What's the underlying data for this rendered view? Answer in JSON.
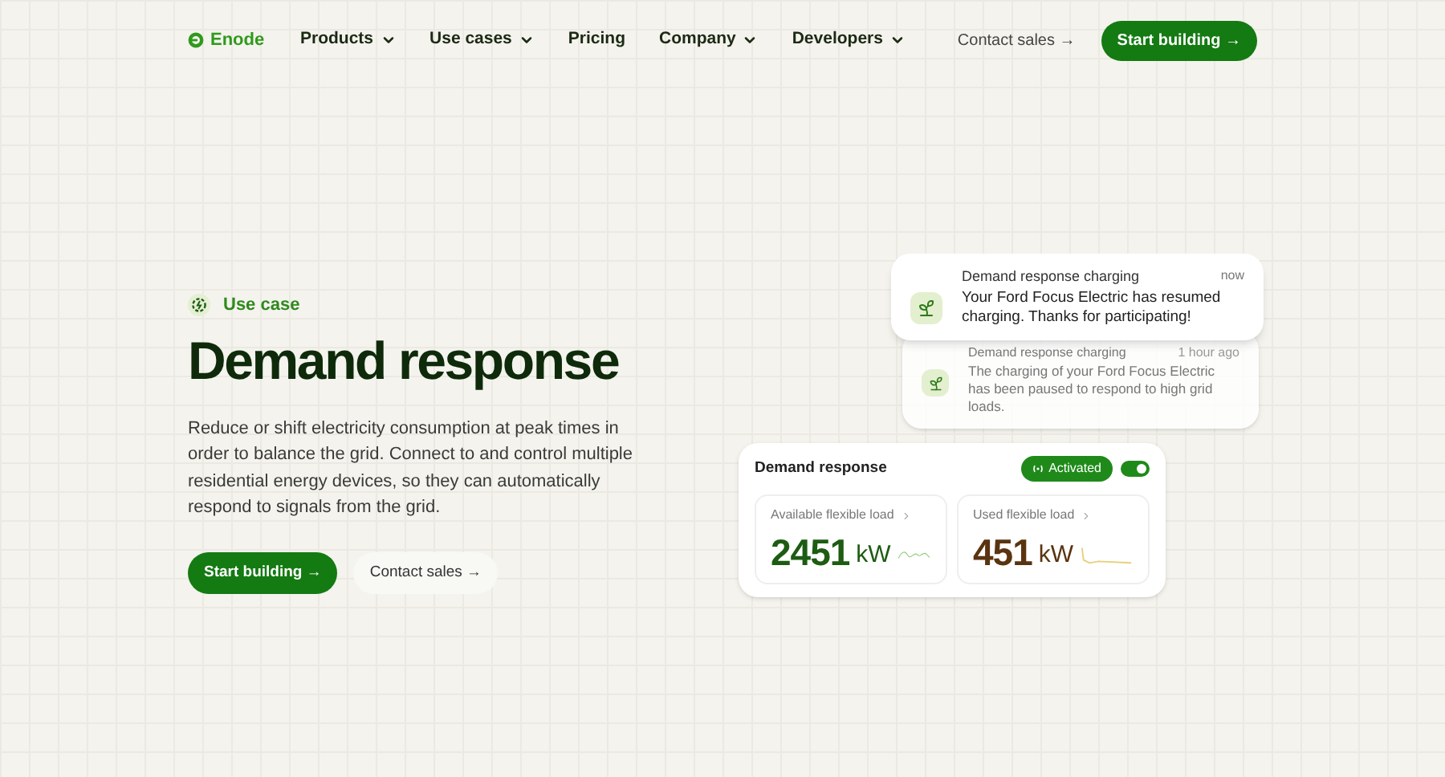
{
  "brand": "Enode",
  "nav": [
    {
      "label": "Products",
      "dropdown": true
    },
    {
      "label": "Use cases",
      "dropdown": true
    },
    {
      "label": "Pricing",
      "dropdown": false
    },
    {
      "label": "Company",
      "dropdown": true
    },
    {
      "label": "Developers",
      "dropdown": true
    }
  ],
  "header_actions": {
    "contact": "Contact sales →",
    "start": "Start building →"
  },
  "hero": {
    "eyebrow": "Use case",
    "title": "Demand response",
    "body": "Reduce or shift electricity consumption at peak times in order to balance the grid. Connect to and control multiple residential energy devices, so they can automatically respond to signals from the grid.",
    "primary": "Start building →",
    "secondary": "Contact sales →"
  },
  "notifications": [
    {
      "title": "Demand response charging",
      "time": "now",
      "text": "Your Ford Focus Electric has resumed charging. Thanks for participating!"
    },
    {
      "title": "Demand response charging",
      "time": "1 hour ago",
      "text": "The charging of your Ford Focus Electric has been paused to respond to high grid loads."
    }
  ],
  "panel": {
    "title": "Demand response",
    "badge": "Activated",
    "on": true,
    "metrics": [
      {
        "label": "Available flexible load",
        "value": "2451",
        "unit": "kW",
        "color": "#1d5c12"
      },
      {
        "label": "Used flexible load",
        "value": "451",
        "unit": "kW",
        "color": "#5a3410"
      }
    ]
  }
}
